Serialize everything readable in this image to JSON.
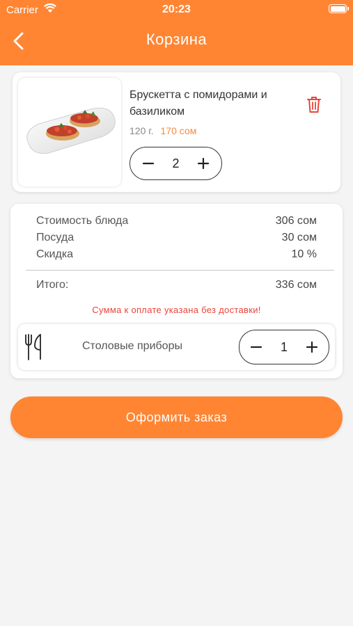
{
  "status_bar": {
    "carrier": "Carrier",
    "time": "20:23"
  },
  "header": {
    "title": "Корзина",
    "back_icon": "chevron-left-icon"
  },
  "cart_item": {
    "name": "Брускетта с помидорами и базиликом",
    "weight": "120 г.",
    "price": "170 сом",
    "quantity": "2",
    "delete_icon": "trash-icon"
  },
  "summary": {
    "rows": [
      {
        "label": "Стоимость блюда",
        "value": "306 сом"
      },
      {
        "label": "Посуда",
        "value": "30 сом"
      },
      {
        "label": "Скидка",
        "value": "10 %"
      }
    ],
    "total": {
      "label": "Итого:",
      "value": "336 сом"
    },
    "delivery_note": "Сумма к оплате указана без доставки!"
  },
  "cutlery": {
    "label": "Столовые приборы",
    "quantity": "1",
    "icon": "cutlery-icon"
  },
  "order_button": {
    "label": "Оформить заказ"
  },
  "colors": {
    "accent": "#ff8533",
    "price": "#f58a42",
    "warning": "#e8453c",
    "background": "#f4f4f4"
  }
}
